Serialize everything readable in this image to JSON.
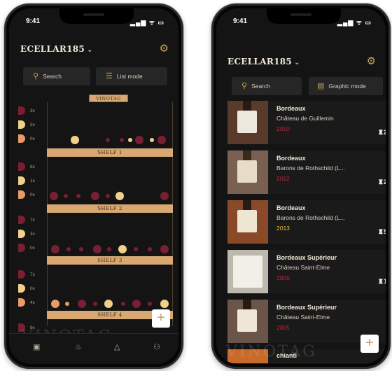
{
  "colors": {
    "red_wine": "#7a1e32",
    "white_wine": "#f1d08a",
    "rose_wine": "#e89a6a",
    "accent": "#c8a25a",
    "year_red": "#c0243a",
    "year_gold": "#e8c030"
  },
  "left_phone": {
    "time": "9:41",
    "status_icons": "▂▄▆ ᯤ ▭",
    "app_title": "ECELLAR185",
    "title_chevron": "⌄",
    "settings_icon": "⚙",
    "search_label": "Search",
    "mode_label": "List mode",
    "rack_label": "VINOTAG",
    "shelves": [
      {
        "label": "SHELF 1",
        "counts": [
          "3x",
          "3x",
          "0x"
        ]
      },
      {
        "label": "SHELF 2",
        "counts": [
          "6x",
          "1x",
          "0x"
        ]
      },
      {
        "label": "SHELF 3",
        "counts": [
          "7x",
          "3x",
          "0x"
        ]
      },
      {
        "label": "SHELF 4",
        "counts": [
          "7x",
          "0x",
          "4x"
        ]
      }
    ],
    "extra_count": "9x",
    "watermark": "VINOTAG",
    "add_icon": "+",
    "tabs": [
      "▣",
      "♨",
      "△",
      "⚇"
    ]
  },
  "right_phone": {
    "time": "9:41",
    "status_icons": "▂▄▆ ᯤ ▭",
    "app_title": "ECELLAR185",
    "title_chevron": "⌄",
    "settings_icon": "⚙",
    "search_label": "Search",
    "mode_label": "Graphic mode",
    "wines": [
      {
        "region": "Bordeaux",
        "name": "Château de Guillemin",
        "year": "2010",
        "qty": "2",
        "type": "red"
      },
      {
        "region": "Bordeaux",
        "name": "Barons de Rothschild (L...",
        "year": "2012",
        "qty": "2",
        "type": "red"
      },
      {
        "region": "Bordeaux",
        "name": "Barons de Rothschild (L...",
        "year": "2013",
        "qty": "5",
        "type": "red"
      },
      {
        "region": "Bordeaux Supérieur",
        "name": "Château Saint-Elme",
        "year": "2005",
        "qty": "1",
        "type": "red"
      },
      {
        "region": "Bordeaux Supérieur",
        "name": "Château Saint-Elme",
        "year": "2005",
        "qty": "",
        "type": "red"
      },
      {
        "region": "chianti",
        "name": "",
        "year": "",
        "qty": "",
        "type": "red"
      }
    ],
    "watermark": "VINOTAG",
    "add_icon": "+"
  }
}
